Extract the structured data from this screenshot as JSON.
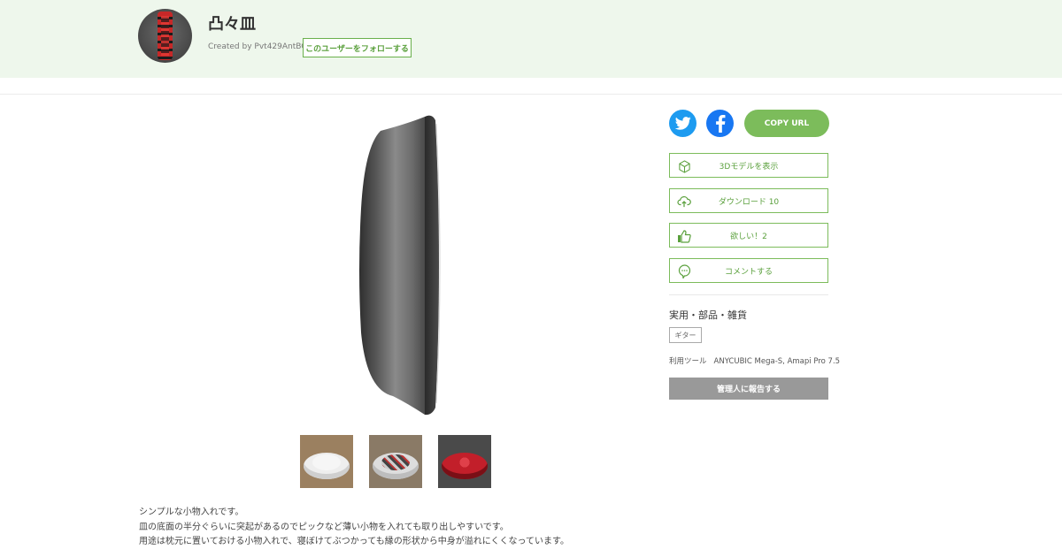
{
  "header": {
    "title": "凸々皿",
    "created_by_prefix": "Created by",
    "username": "Pvt429AntBGJ",
    "follow_label": "このユーザーをフォローする"
  },
  "share": {
    "twitter_icon": "twitter-icon",
    "facebook_icon": "facebook-icon",
    "copy_url_label": "COPY URL",
    "twitter_color": "#1d9bf0",
    "facebook_color": "#1877f2",
    "accent_color": "#7cbc5b"
  },
  "actions": {
    "view_3d": {
      "label": "3Dモデルを表示",
      "icon": "cube-icon"
    },
    "download": {
      "label": "ダウンロード 10",
      "icon": "cloud-upload-icon"
    },
    "like": {
      "label": "欲しい！2",
      "icon": "thumbs-up-icon"
    },
    "comment": {
      "label": "コメントする",
      "icon": "comment-icon"
    }
  },
  "details": {
    "category": "実用・部品・雑貨",
    "tag": "ギター",
    "tools_label": "利用ツール",
    "tools_value": "ANYCUBIC Mega-S, Amapi Pro 7.5",
    "report_label": "管理人に報告する"
  },
  "description": {
    "line1": "シンプルな小物入れです。",
    "line2": "皿の底面の半分ぐらいに突起があるのでピックなど薄い小物を入れても取り出しやすいです。",
    "line3": "用途は枕元に置いておける小物入れで、寝ぼけてぶつかっても縁の形状から中身が溢れにくくなっています。"
  }
}
